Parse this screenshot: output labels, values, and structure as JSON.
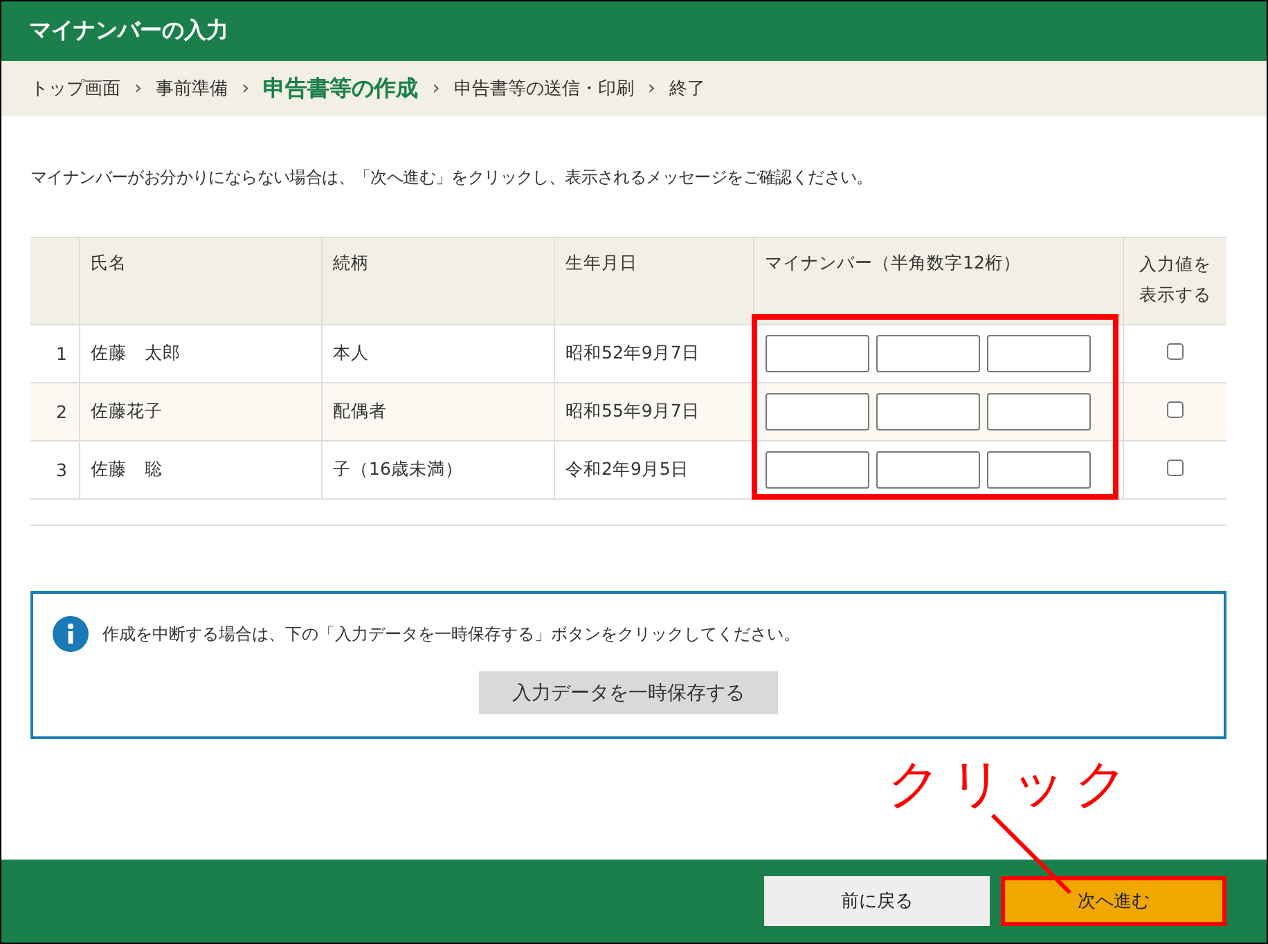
{
  "header": {
    "title": "マイナンバーの入力"
  },
  "breadcrumb": [
    {
      "label": "トップ画面",
      "selected": false
    },
    {
      "label": "事前準備",
      "selected": false
    },
    {
      "label": "申告書等の作成",
      "selected": true
    },
    {
      "label": "申告書等の送信・印刷",
      "selected": false
    },
    {
      "label": "終了",
      "selected": false
    }
  ],
  "breadcrumb_separator": "›",
  "instruction": "マイナンバーがお分かりにならない場合は、「次へ進む」をクリックし、表示されるメッセージをご確認ください。",
  "table": {
    "columns": [
      "",
      "氏名",
      "続柄",
      "生年月日",
      "マイナンバー（半角数字12桁）",
      "入力値を表示する"
    ],
    "rows": [
      {
        "number": "1",
        "name": "佐藤　太郎",
        "relation": "本人",
        "birth": "昭和52年9月7日",
        "checked": false
      },
      {
        "number": "2",
        "name": "佐藤花子",
        "relation": "配偶者",
        "birth": "昭和55年9月7日",
        "checked": false
      },
      {
        "number": "3",
        "name": "佐藤　聡",
        "relation": "子（16歳未満）",
        "birth": "令和2年9月5日",
        "checked": false
      }
    ]
  },
  "info": {
    "text": "作成を中断する場合は、下の「入力データを一時保存する」ボタンをクリックしてください。",
    "button": "入力データを一時保存する"
  },
  "footer": {
    "buttons": [
      {
        "label": "前に戻る",
        "kind": "secondary"
      },
      {
        "label": "次へ進む",
        "kind": "primary"
      }
    ]
  },
  "annotation": {
    "text": "クリック"
  }
}
